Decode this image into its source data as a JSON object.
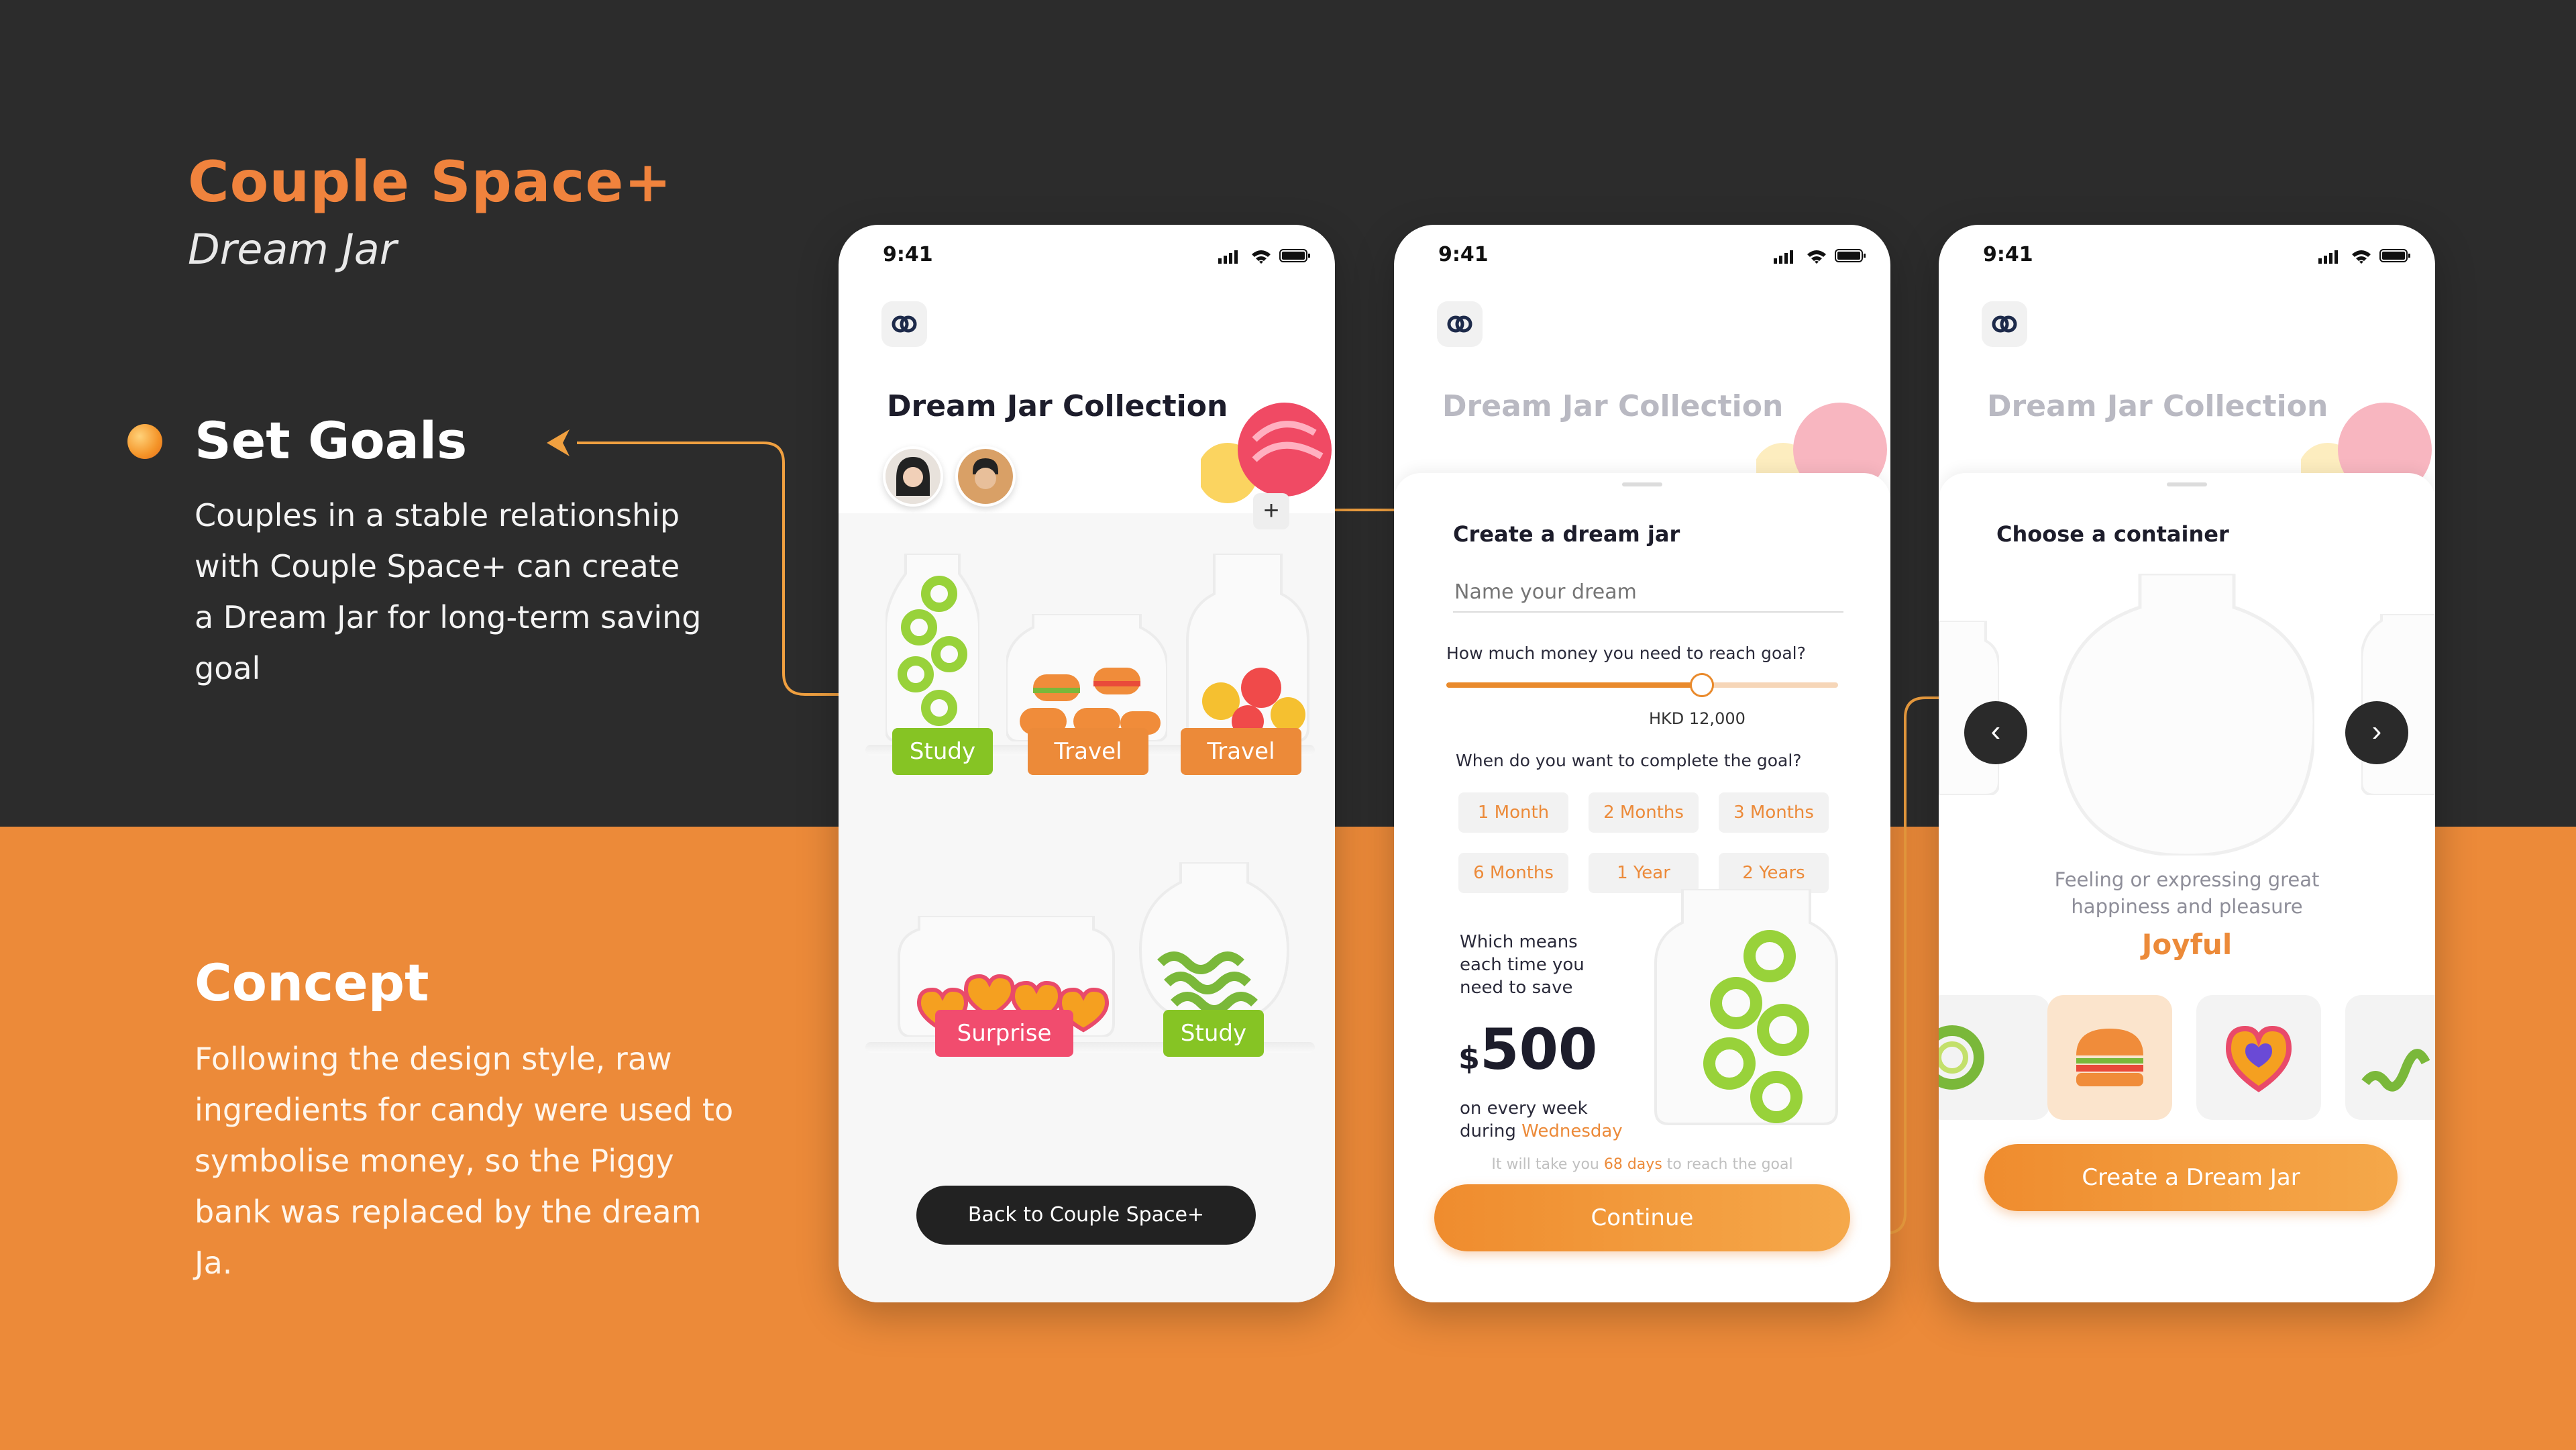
{
  "brand": {
    "title": "Couple Space+",
    "subtitle": "Dream Jar"
  },
  "goals": {
    "title": "Set Goals",
    "text": "Couples in a stable relationship with Couple Space+ can create a Dream Jar for long-term saving goal"
  },
  "concept": {
    "title": "Concept",
    "text": "Following the design style, raw ingredients for candy were used to symbolise money, so the Piggy bank was replaced by the dream Ja."
  },
  "colors": {
    "accent": "#ec8a39",
    "dark": "#2c2c2c",
    "green": "#86c424",
    "pink": "#f14c6e"
  },
  "screen1": {
    "time": "9:41",
    "title": "Dream Jar Collection",
    "add_icon": "+",
    "jars": [
      {
        "label": "Study",
        "color": "green"
      },
      {
        "label": "Travel",
        "color": "orange"
      },
      {
        "label": "Travel",
        "color": "orange"
      },
      {
        "label": "Surprise",
        "color": "pink"
      },
      {
        "label": "Study",
        "color": "green"
      }
    ],
    "back_button": "Back to Couple Space+"
  },
  "screen2": {
    "time": "9:41",
    "title": "Dream Jar Collection",
    "sheet_title": "Create a dream jar",
    "name_placeholder": "Name your dream",
    "money_question": "How much money you need to reach goal?",
    "slider_value": "HKD 12,000",
    "slider_fraction": 0.65,
    "time_question": "When do you want to complete the goal?",
    "durations": [
      "1 Month",
      "2 Months",
      "3 Months",
      "6 Months",
      "1 Year",
      "2 Years"
    ],
    "means_text": "Which means each time you need to save",
    "currency": "$",
    "amount": "500",
    "frequency_prefix": "on every week",
    "frequency_during": "during",
    "frequency_day": "Wednesday",
    "hint_prefix": "It will take you",
    "hint_days": "68 days",
    "hint_suffix": "to reach the goal",
    "continue_button": "Continue"
  },
  "screen3": {
    "time": "9:41",
    "title": "Dream Jar Collection",
    "sheet_title": "Choose a container",
    "feeling_description": "Feeling or expressing great happiness and pleasure",
    "feeling_name": "Joyful",
    "prev_icon": "‹",
    "next_icon": "›",
    "candies": [
      "ring-candy-icon",
      "burger-candy-icon",
      "heart-candy-icon",
      "ribbon-candy-icon"
    ],
    "create_button": "Create a Dream Jar"
  }
}
